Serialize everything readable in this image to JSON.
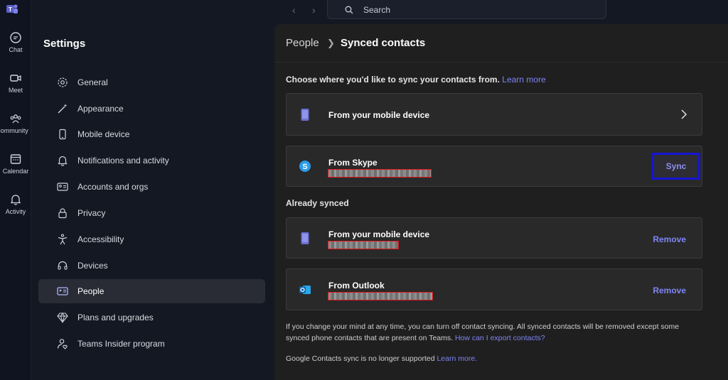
{
  "rail": {
    "items": [
      {
        "label": "Chat",
        "icon": "chat-icon"
      },
      {
        "label": "Meet",
        "icon": "video-icon"
      },
      {
        "label": "Community",
        "icon": "community-icon"
      },
      {
        "label": "Calendar",
        "icon": "calendar-icon"
      },
      {
        "label": "Activity",
        "icon": "bell-icon"
      }
    ]
  },
  "search": {
    "label": "Search"
  },
  "settings": {
    "title": "Settings",
    "items": [
      {
        "label": "General",
        "icon": "gear-icon"
      },
      {
        "label": "Appearance",
        "icon": "wand-icon"
      },
      {
        "label": "Mobile device",
        "icon": "phone-icon"
      },
      {
        "label": "Notifications and activity",
        "icon": "bell-icon"
      },
      {
        "label": "Accounts and orgs",
        "icon": "id-card-icon"
      },
      {
        "label": "Privacy",
        "icon": "lock-icon"
      },
      {
        "label": "Accessibility",
        "icon": "accessibility-icon"
      },
      {
        "label": "Devices",
        "icon": "headset-icon"
      },
      {
        "label": "People",
        "icon": "contact-card-icon",
        "selected": true
      },
      {
        "label": "Plans and upgrades",
        "icon": "diamond-icon"
      },
      {
        "label": "Teams Insider program",
        "icon": "insider-icon"
      }
    ]
  },
  "main": {
    "breadcrumb": {
      "parent": "People",
      "current": "Synced contacts"
    },
    "intro": "Choose where you'd like to sync your contacts from.",
    "intro_link": "Learn more",
    "sources": {
      "mobile": {
        "title": "From your mobile device"
      },
      "skype": {
        "title": "From Skype",
        "button": "Sync"
      }
    },
    "already_synced_heading": "Already synced",
    "synced": {
      "mobile": {
        "title": "From your mobile device",
        "button": "Remove"
      },
      "outlook": {
        "title": "From Outlook",
        "button": "Remove"
      }
    },
    "note_text": "If you change your mind at any time, you can turn off contact syncing. All synced contacts will be removed except some synced phone contacts that are present on Teams.",
    "note_link": "How can I export contacts?",
    "google_text": "Google Contacts sync is no longer supported",
    "google_link": "Learn more."
  },
  "colors": {
    "accent": "#7f85f5",
    "highlight_border": "#1515d6",
    "redaction_border": "#e2161a"
  }
}
